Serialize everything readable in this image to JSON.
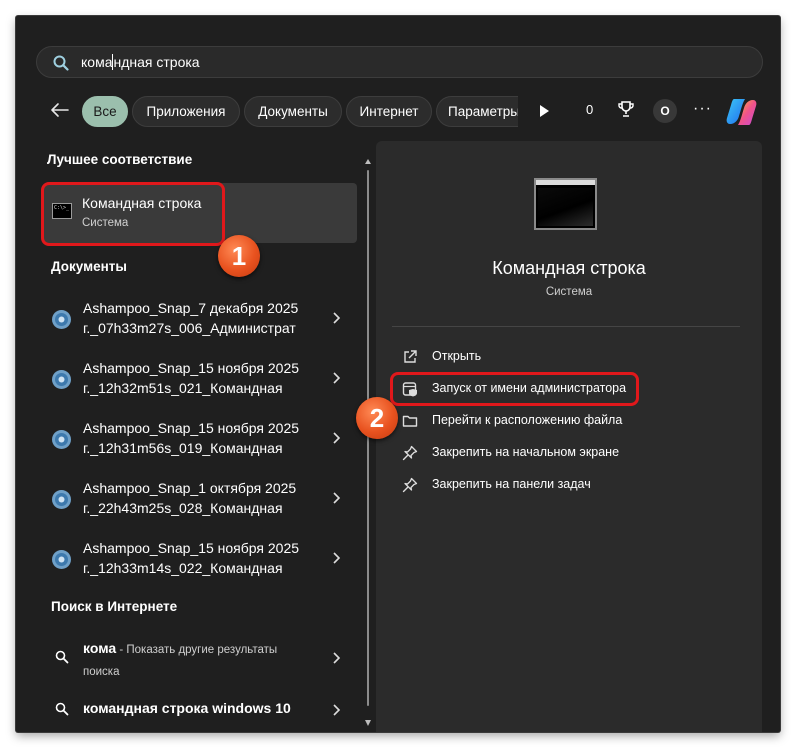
{
  "search": {
    "value_before_caret": "кома",
    "value_after_caret": "ндная строка"
  },
  "filters": {
    "chips": [
      "Все",
      "Приложения",
      "Документы",
      "Интернет",
      "Параметры"
    ],
    "counter": "0",
    "avatar_letter": "O",
    "more": "···"
  },
  "left": {
    "best_match_heading": "Лучшее соответствие",
    "best_match": {
      "title": "Командная строка",
      "subtitle": "Система",
      "icon_text": "C:\\>_"
    },
    "documents_heading": "Документы",
    "documents": [
      {
        "line1": "Ashampoo_Snap_7 декабря 2025",
        "line2": "г._07h33m27s_006_Администрат"
      },
      {
        "line1": "Ashampoo_Snap_15 ноября 2025",
        "line2": "г._12h32m51s_021_Командная"
      },
      {
        "line1": "Ashampoo_Snap_15 ноября 2025",
        "line2": "г._12h31m56s_019_Командная"
      },
      {
        "line1": "Ashampoo_Snap_1 октября 2025",
        "line2": "г._22h43m25s_028_Командная"
      },
      {
        "line1": "Ashampoo_Snap_15 ноября 2025",
        "line2": "г._12h33m14s_022_Командная"
      }
    ],
    "web_heading": "Поиск в Интернете",
    "web": [
      {
        "term": "кома",
        "hint": " - Показать другие результаты",
        "hint2": "поиска"
      },
      {
        "term": "командная строка windows 10"
      }
    ]
  },
  "right": {
    "title": "Командная строка",
    "subtitle": "Система",
    "actions": [
      {
        "label": "Открыть",
        "icon": "open-external-icon"
      },
      {
        "label": "Запуск от имени администратора",
        "icon": "admin-shield-icon"
      },
      {
        "label": "Перейти к расположению файла",
        "icon": "folder-icon"
      },
      {
        "label": "Закрепить на начальном экране",
        "icon": "pin-icon"
      },
      {
        "label": "Закрепить на панели задач",
        "icon": "pin-icon"
      }
    ]
  },
  "annotations": {
    "badge1": "1",
    "badge2": "2"
  },
  "colors": {
    "highlight": "#e0181b",
    "badge": "#e8521f",
    "active_chip": "#9bbfad"
  }
}
